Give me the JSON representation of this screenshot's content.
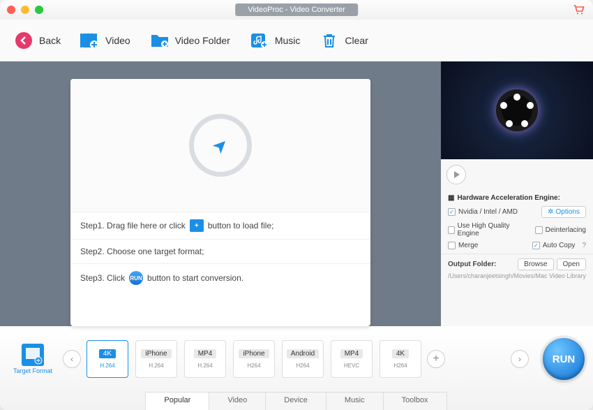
{
  "title": "VideoProc - Video Converter",
  "toolbar": {
    "back": "Back",
    "video": "Video",
    "folder": "Video Folder",
    "music": "Music",
    "clear": "Clear"
  },
  "steps": {
    "s1a": "Step1. Drag file here or click",
    "s1b": "button to load file;",
    "s2": "Step2. Choose one target format;",
    "s3a": "Step3. Click",
    "s3b": "button to start conversion.",
    "miniRun": "RUN"
  },
  "side": {
    "hw_title": "Hardware Acceleration Engine:",
    "hw_vendor": "Nvidia / Intel / AMD",
    "options": "Options",
    "hq": "Use High Quality Engine",
    "deint": "Deinterlacing",
    "merge": "Merge",
    "autocopy": "Auto Copy",
    "output_label": "Output Folder:",
    "browse": "Browse",
    "open": "Open",
    "path": "/Users/charanjeetsingh/Movies/Mac Video Library"
  },
  "target_label": "Target Format",
  "presets": [
    {
      "top": "4K",
      "bot": "H.264",
      "active": true
    },
    {
      "top": "iPhone",
      "bot": "H.264",
      "active": false
    },
    {
      "top": "MP4",
      "bot": "H.264",
      "active": false
    },
    {
      "top": "iPhone",
      "bot": "H264",
      "active": false
    },
    {
      "top": "Android",
      "bot": "H264",
      "active": false
    },
    {
      "top": "MP4",
      "bot": "HEVC",
      "active": false
    },
    {
      "top": "4K",
      "bot": "H264",
      "active": false
    }
  ],
  "tabs": [
    "Popular",
    "Video",
    "Device",
    "Music",
    "Toolbox"
  ],
  "run": "RUN"
}
